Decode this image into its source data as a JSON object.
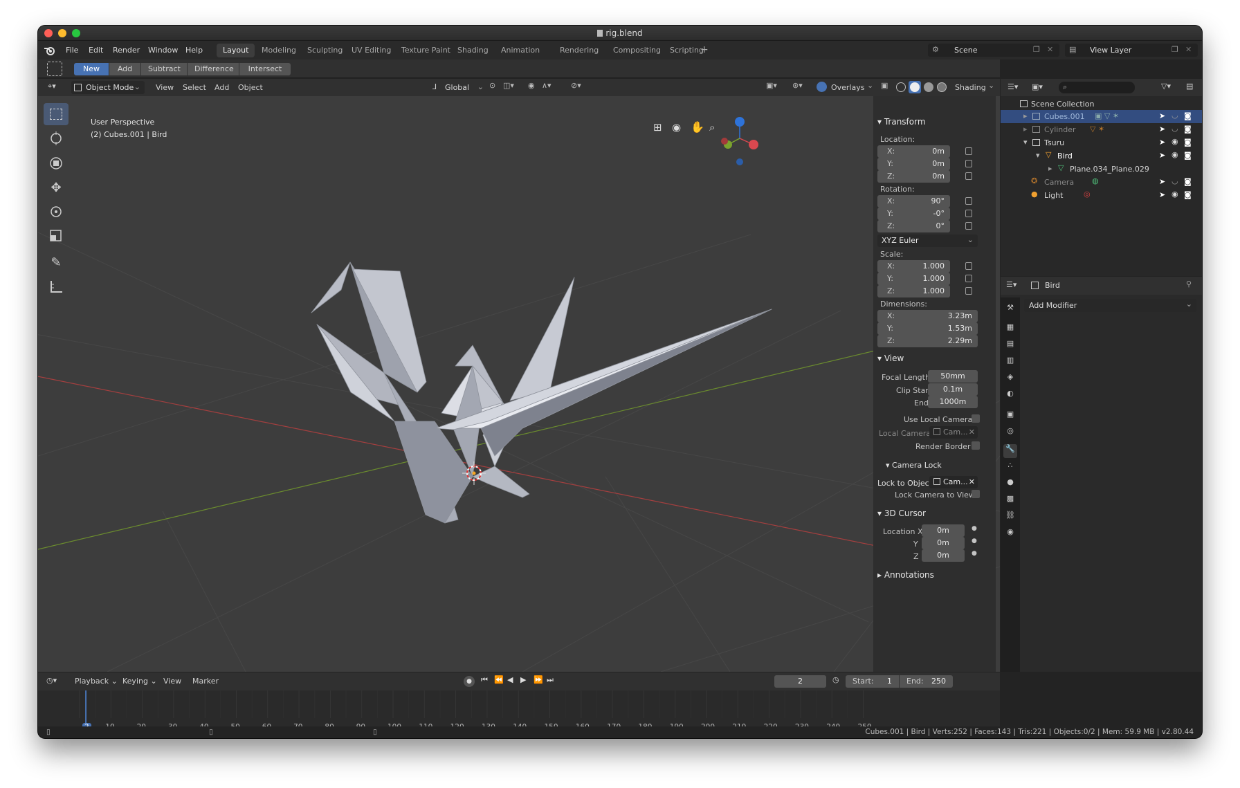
{
  "window": {
    "title": "rig.blend"
  },
  "menu": {
    "items": [
      "File",
      "Edit",
      "Render",
      "Window",
      "Help"
    ]
  },
  "workspaces": [
    "Layout",
    "Modeling",
    "Sculpting",
    "UV Editing",
    "Texture Paint",
    "Shading",
    "Animation",
    "Rendering",
    "Compositing",
    "Scripting"
  ],
  "active_workspace": "Layout",
  "scene": {
    "label": "Scene",
    "view_layer": "View Layer"
  },
  "tool_header": {
    "buttons": [
      "New",
      "Add",
      "Subtract",
      "Difference",
      "Intersect"
    ],
    "active": "New"
  },
  "viewport_header": {
    "mode": "Object Mode",
    "menus": [
      "View",
      "Select",
      "Add",
      "Object"
    ],
    "orientation": "Global",
    "overlays": "Overlays",
    "shading": "Shading"
  },
  "viewport": {
    "perspective": "User Perspective",
    "context": "(2) Cubes.001 | Bird"
  },
  "npanel": {
    "transform": {
      "header": "Transform",
      "location_label": "Location:",
      "location": {
        "x": "0m",
        "y": "0m",
        "z": "0m"
      },
      "rotation_label": "Rotation:",
      "rotation": {
        "x": "90°",
        "y": "-0°",
        "z": "0°"
      },
      "rotation_mode": "XYZ Euler",
      "scale_label": "Scale:",
      "scale": {
        "x": "1.000",
        "y": "1.000",
        "z": "1.000"
      },
      "dimensions_label": "Dimensions:",
      "dimensions": {
        "x": "3.23m",
        "y": "1.53m",
        "z": "2.29m"
      },
      "axis": {
        "x": "X:",
        "y": "Y:",
        "z": "Z:"
      }
    },
    "view": {
      "header": "View",
      "focal_length_label": "Focal Length",
      "focal_length": "50mm",
      "clip_start_label": "Clip Start",
      "clip_start": "0.1m",
      "end_label": "End",
      "end": "1000m",
      "use_local_camera": "Use Local Camera",
      "local_camera_label": "Local Camera",
      "local_camera": "Cam...",
      "render_border": "Render Border"
    },
    "camera_lock": {
      "header": "Camera Lock",
      "lock_to_object_label": "Lock to Object",
      "lock_to_object": "Cam...",
      "lock_camera_to_view": "Lock Camera to View"
    },
    "cursor": {
      "header": "3D Cursor",
      "location_x_label": "Location X",
      "y_label": "Y",
      "z_label": "Z",
      "x": "0m",
      "y": "0m",
      "z": "0m"
    },
    "annotations": {
      "header": "Annotations"
    }
  },
  "outliner": {
    "rows": [
      {
        "label": "Scene Collection",
        "selected": false
      },
      {
        "label": "Cubes.001",
        "selected": true
      },
      {
        "label": "Cylinder",
        "selected": false
      },
      {
        "label": "Tsuru",
        "selected": false
      },
      {
        "label": "Bird",
        "selected": false
      },
      {
        "label": "Plane.034_Plane.029",
        "selected": false
      },
      {
        "label": "Camera",
        "selected": false
      },
      {
        "label": "Light",
        "selected": false
      }
    ]
  },
  "properties": {
    "object_name": "Bird",
    "add_modifier": "Add Modifier"
  },
  "timeline": {
    "menus": [
      "Playback",
      "Keying",
      "View",
      "Marker"
    ],
    "current_frame": "2",
    "start_label": "Start:",
    "start": "1",
    "end_label": "End:",
    "end": "250",
    "ticks": [
      "2",
      "10",
      "20",
      "30",
      "40",
      "50",
      "60",
      "70",
      "80",
      "90",
      "100",
      "110",
      "120",
      "130",
      "140",
      "150",
      "160",
      "170",
      "180",
      "190",
      "200",
      "210",
      "220",
      "230",
      "240",
      "250"
    ]
  },
  "status": {
    "text": "Cubes.001 | Bird | Verts:252 | Faces:143 | Tris:221 | Objects:0/2 | Mem: 59.9 MB | v2.80.44"
  },
  "colors": {
    "accent": "#4772b3",
    "selected_row": "#334d80",
    "viewport_bg": "#3d3d3d",
    "axis_x": "#a53f3f",
    "axis_y": "#6b8c2e"
  }
}
